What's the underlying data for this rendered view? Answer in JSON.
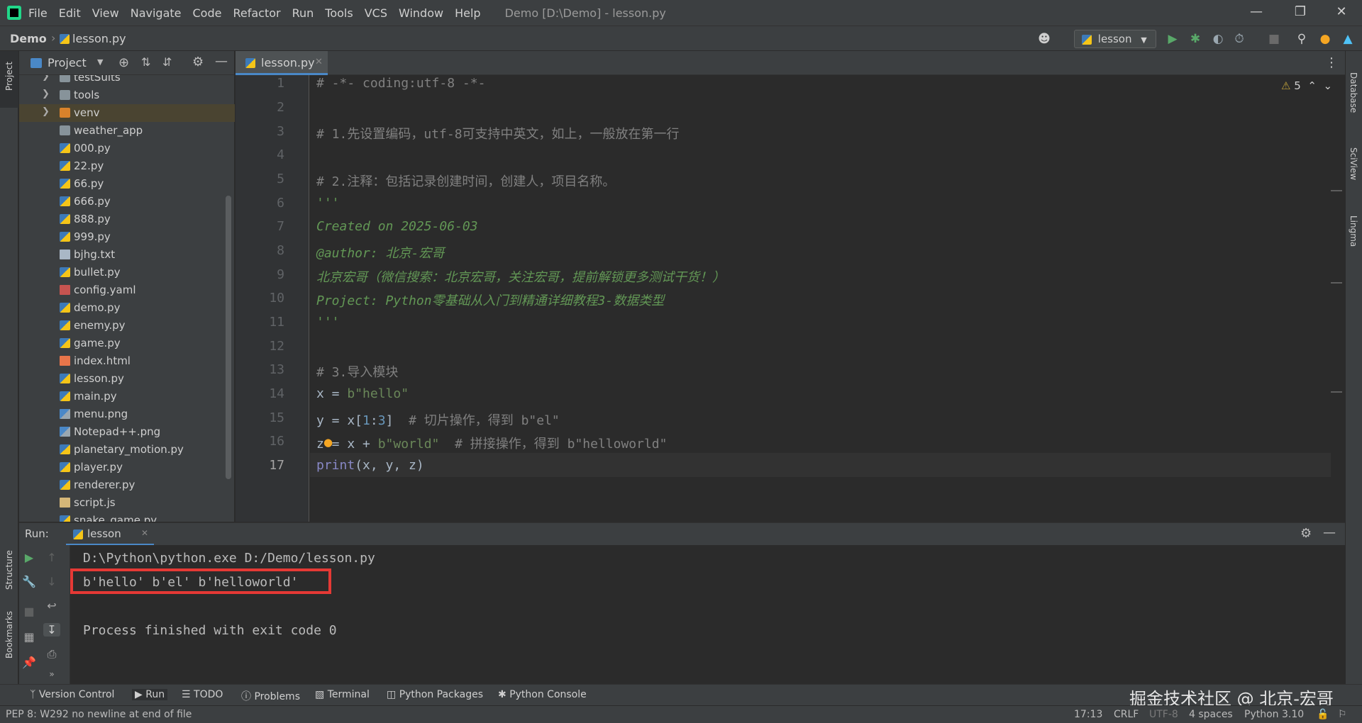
{
  "menubar": {
    "items": [
      "File",
      "Edit",
      "View",
      "Navigate",
      "Code",
      "Refactor",
      "Run",
      "Tools",
      "VCS",
      "Window",
      "Help"
    ],
    "window_title": "Demo [D:\\Demo] - lesson.py"
  },
  "navbar": {
    "project": "Demo",
    "file": "lesson.py",
    "run_config": "lesson"
  },
  "project_panel": {
    "title": "Project",
    "items": [
      {
        "label": "testSuits",
        "type": "folder"
      },
      {
        "label": "tools",
        "type": "folder"
      },
      {
        "label": "venv",
        "type": "folder-excluded"
      },
      {
        "label": "weather_app",
        "type": "folder"
      },
      {
        "label": "000.py",
        "type": "py"
      },
      {
        "label": "22.py",
        "type": "py"
      },
      {
        "label": "66.py",
        "type": "py"
      },
      {
        "label": "666.py",
        "type": "py"
      },
      {
        "label": "888.py",
        "type": "py"
      },
      {
        "label": "999.py",
        "type": "py"
      },
      {
        "label": "bjhg.txt",
        "type": "txt"
      },
      {
        "label": "bullet.py",
        "type": "py"
      },
      {
        "label": "config.yaml",
        "type": "yaml"
      },
      {
        "label": "demo.py",
        "type": "py"
      },
      {
        "label": "enemy.py",
        "type": "py"
      },
      {
        "label": "game.py",
        "type": "py"
      },
      {
        "label": "index.html",
        "type": "html"
      },
      {
        "label": "lesson.py",
        "type": "py"
      },
      {
        "label": "main.py",
        "type": "py"
      },
      {
        "label": "menu.png",
        "type": "png"
      },
      {
        "label": "Notepad++.png",
        "type": "png"
      },
      {
        "label": "planetary_motion.py",
        "type": "py"
      },
      {
        "label": "player.py",
        "type": "py"
      },
      {
        "label": "renderer.py",
        "type": "py"
      },
      {
        "label": "script.js",
        "type": "js"
      },
      {
        "label": "snake_game.py",
        "type": "py"
      }
    ]
  },
  "editor": {
    "tab_label": "lesson.py",
    "warnings_count": "5",
    "line_numbers": [
      "1",
      "2",
      "3",
      "4",
      "5",
      "6",
      "7",
      "8",
      "9",
      "10",
      "11",
      "12",
      "13",
      "14",
      "15",
      "16",
      "17"
    ],
    "lines": {
      "l1": "# -*- coding:utf-8 -*-",
      "l3": "# 1.先设置编码，utf-8可支持中英文，如上，一般放在第一行",
      "l5": "# 2.注释：包括记录创建时间，创建人，项目名称。",
      "l6": "'''",
      "l7": "Created on 2025-06-03",
      "l8": "@author: 北京-宏哥",
      "l9": "北京宏哥（微信搜索：北京宏哥，关注宏哥，提前解锁更多测试干货！）",
      "l10": "Project: Python零基础从入门到精通详细教程3-数据类型",
      "l11": "'''",
      "l13": "# 3.导入模块",
      "l14_a": "x = ",
      "l14_b": "b\"hello\"",
      "l15_a": "y = x[",
      "l15_n1": "1",
      "l15_c": ":",
      "l15_n2": "3",
      "l15_d": "]  ",
      "l15_cmt": "# 切片操作，得到 b\"el\"",
      "l16_a": "z = x + ",
      "l16_b": "b\"world\"",
      "l16_c": "  ",
      "l16_cmt": "# 拼接操作，得到 b\"helloworld\"",
      "l17_fn": "print",
      "l17_args": "(x, y, z)"
    }
  },
  "run_panel": {
    "label": "Run:",
    "tab": "lesson",
    "console": [
      "D:\\Python\\python.exe D:/Demo/lesson.py",
      "b'hello' b'el' b'helloworld'",
      "",
      "Process finished with exit code 0"
    ]
  },
  "side_labels": {
    "project": "Project",
    "structure": "Structure",
    "bookmarks": "Bookmarks",
    "database": "Database",
    "sciview": "SciView",
    "lingma": "Lingma"
  },
  "bottom_tools": [
    "Version Control",
    "Run",
    "TODO",
    "Problems",
    "Terminal",
    "Python Packages",
    "Python Console"
  ],
  "watermark": "掘金技术社区 @ 北京-宏哥",
  "status": {
    "message": "PEP 8: W292 no newline at end of file",
    "position": "17:13",
    "line_sep": "CRLF",
    "encoding": "UTF-8",
    "indent": "4 spaces",
    "interpreter": "Python 3.10"
  },
  "colors": {
    "accent": "#4a88c7",
    "highlight_box": "#e53935",
    "run_green": "#59a869"
  }
}
